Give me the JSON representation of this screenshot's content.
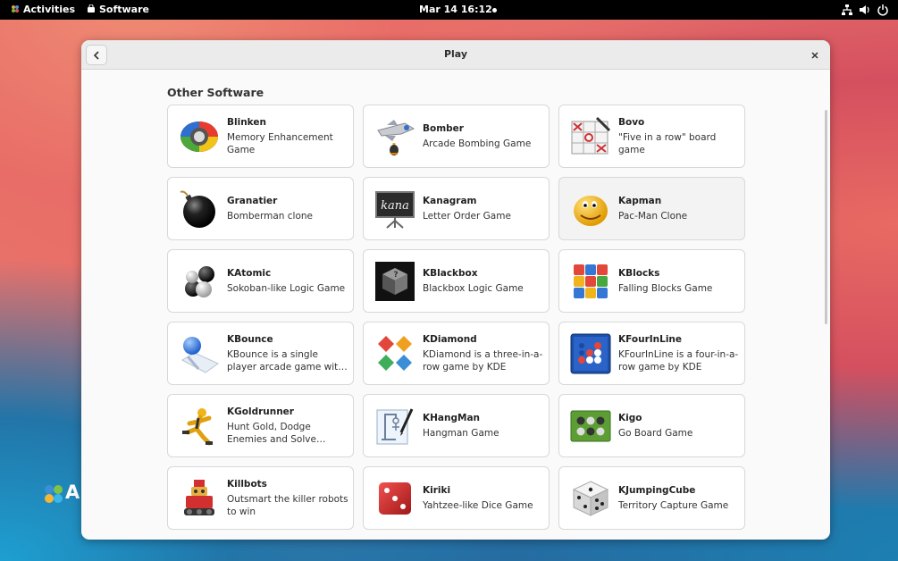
{
  "topbar": {
    "activities": "Activities",
    "app_name": "Software",
    "datetime": "Mar 14  16:12"
  },
  "window": {
    "title": "Play",
    "section_title": "Other Software"
  },
  "apps": [
    {
      "name": "Blinken",
      "desc": "Memory Enhancement Game",
      "icon": "blinken-icon"
    },
    {
      "name": "Bomber",
      "desc": "Arcade Bombing Game",
      "icon": "bomber-icon"
    },
    {
      "name": "Bovo",
      "desc": "\"Five in a row\" board game",
      "icon": "bovo-icon"
    },
    {
      "name": "Granatier",
      "desc": "Bomberman clone",
      "icon": "granatier-icon"
    },
    {
      "name": "Kanagram",
      "desc": "Letter Order Game",
      "icon": "kanagram-icon"
    },
    {
      "name": "Kapman",
      "desc": "Pac-Man Clone",
      "icon": "kapman-icon"
    },
    {
      "name": "KAtomic",
      "desc": "Sokoban-like Logic Game",
      "icon": "katomic-icon"
    },
    {
      "name": "KBlackbox",
      "desc": "Blackbox Logic Game",
      "icon": "kblackbox-icon"
    },
    {
      "name": "KBlocks",
      "desc": "Falling Blocks Game",
      "icon": "kblocks-icon"
    },
    {
      "name": "KBounce",
      "desc": "KBounce is a single player arcade game with the elements of puzzle",
      "icon": "kbounce-icon"
    },
    {
      "name": "KDiamond",
      "desc": "KDiamond is a three-in-a-row game by KDE",
      "icon": "kdiamond-icon"
    },
    {
      "name": "KFourInLine",
      "desc": "KFourInLine is a four-in-a-row game by KDE",
      "icon": "kfourinline-icon"
    },
    {
      "name": "KGoldrunner",
      "desc": "Hunt Gold, Dodge Enemies and Solve Puzzles",
      "icon": "kgoldrunner-icon"
    },
    {
      "name": "KHangMan",
      "desc": "Hangman Game",
      "icon": "khangman-icon"
    },
    {
      "name": "Kigo",
      "desc": "Go Board Game",
      "icon": "kigo-icon"
    },
    {
      "name": "Killbots",
      "desc": "Outsmart the killer robots to win",
      "icon": "killbots-icon"
    },
    {
      "name": "Kiriki",
      "desc": "Yahtzee-like Dice Game",
      "icon": "kiriki-icon"
    },
    {
      "name": "KJumpingCube",
      "desc": "Territory Capture Game",
      "icon": "kjumpingcube-icon"
    }
  ],
  "desktop": {
    "logo_text": "A"
  }
}
